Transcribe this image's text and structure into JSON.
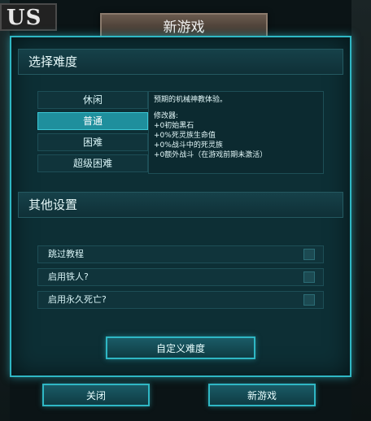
{
  "logo": {
    "text": "US"
  },
  "window": {
    "title": "新游戏"
  },
  "difficulty": {
    "header": "选择难度",
    "options": [
      {
        "label": "休闲",
        "selected": false
      },
      {
        "label": "普通",
        "selected": true
      },
      {
        "label": "困难",
        "selected": false
      },
      {
        "label": "超级困难",
        "selected": false
      }
    ],
    "description": "预期的机械神教体验。",
    "modifiers_title": "修改器:",
    "modifiers": [
      "+0初始黑石",
      "+0%死灵族生命值",
      "+0%战斗中的死灵族",
      "+0额外战斗（在游戏前期未激活）"
    ]
  },
  "other_settings": {
    "header": "其他设置",
    "options": [
      {
        "label": "跳过教程",
        "checked": false
      },
      {
        "label": "启用铁人?",
        "checked": false
      },
      {
        "label": "启用永久死亡?",
        "checked": false
      }
    ]
  },
  "buttons": {
    "custom_difficulty": "自定义难度",
    "close": "关闭",
    "new_game": "新游戏"
  },
  "colors": {
    "accent": "#2fb7c4",
    "selected": "#1f8f9d",
    "panel": "#0d2f35",
    "title_tab": "#6a5a4e"
  }
}
